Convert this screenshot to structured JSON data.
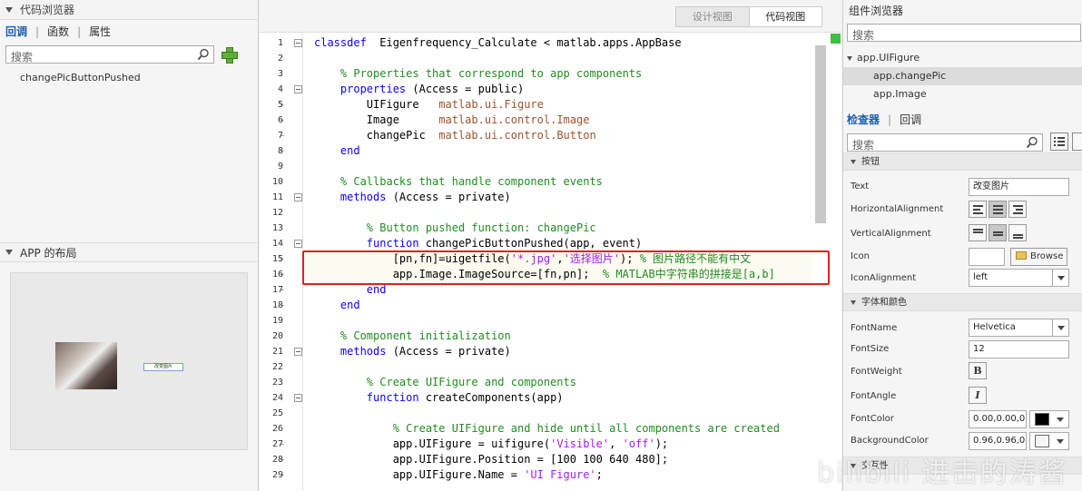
{
  "code_browser": {
    "title": "代码浏览器",
    "tabs": [
      "回调",
      "函数",
      "属性"
    ],
    "search_placeholder": "搜索",
    "callbacks": [
      "changePicButtonPushed"
    ]
  },
  "app_layout": {
    "title": "APP 的布局",
    "button_label": "改变图片"
  },
  "editor": {
    "view_tabs": [
      "设计视图",
      "代码视图"
    ],
    "active_view": "代码视图",
    "lines": [
      {
        "n": 1,
        "segs": [
          [
            "kw",
            "classdef"
          ],
          [
            "",
            "  Eigenfrequency_Calculate < matlab.apps.AppBase"
          ]
        ]
      },
      {
        "n": 2,
        "segs": []
      },
      {
        "n": 3,
        "segs": [
          [
            "",
            "    "
          ],
          [
            "cm",
            "% Properties that correspond to app components"
          ]
        ]
      },
      {
        "n": 4,
        "segs": [
          [
            "",
            "    "
          ],
          [
            "kw",
            "properties"
          ],
          [
            "",
            " (Access = public)"
          ]
        ]
      },
      {
        "n": 5,
        "segs": [
          [
            "",
            "        UIFigure   "
          ],
          [
            "cls",
            "matlab.ui.Figure"
          ]
        ]
      },
      {
        "n": 6,
        "segs": [
          [
            "",
            "        Image      "
          ],
          [
            "cls",
            "matlab.ui.control.Image"
          ]
        ]
      },
      {
        "n": 7,
        "segs": [
          [
            "",
            "        changePic  "
          ],
          [
            "cls",
            "matlab.ui.control.Button"
          ]
        ]
      },
      {
        "n": 8,
        "segs": [
          [
            "",
            "    "
          ],
          [
            "kw",
            "end"
          ]
        ]
      },
      {
        "n": 9,
        "segs": []
      },
      {
        "n": 10,
        "segs": [
          [
            "",
            "    "
          ],
          [
            "cm",
            "% Callbacks that handle component events"
          ]
        ]
      },
      {
        "n": 11,
        "segs": [
          [
            "",
            "    "
          ],
          [
            "kw",
            "methods"
          ],
          [
            "",
            " (Access = private)"
          ]
        ]
      },
      {
        "n": 12,
        "segs": []
      },
      {
        "n": 13,
        "segs": [
          [
            "",
            "        "
          ],
          [
            "cm",
            "% Button pushed function: changePic"
          ]
        ]
      },
      {
        "n": 14,
        "segs": [
          [
            "",
            "        "
          ],
          [
            "kw",
            "function"
          ],
          [
            "",
            " changePicButtonPushed(app, event)"
          ]
        ]
      },
      {
        "n": 15,
        "segs": [
          [
            "",
            "            [pn,fn]=uigetfile("
          ],
          [
            "st",
            "'*.jpg'"
          ],
          [
            "",
            ","
          ],
          [
            "st",
            "'选择图片'"
          ],
          [
            "",
            "); "
          ],
          [
            "cm",
            "% 图片路径不能有中文"
          ]
        ]
      },
      {
        "n": 16,
        "segs": [
          [
            "",
            "            app.Image.ImageSource=[fn,pn];  "
          ],
          [
            "cm",
            "% MATLAB中字符串的拼接是[a,b]"
          ]
        ]
      },
      {
        "n": 17,
        "segs": [
          [
            "",
            "        "
          ],
          [
            "kw",
            "end"
          ]
        ]
      },
      {
        "n": 18,
        "segs": [
          [
            "",
            "    "
          ],
          [
            "kw",
            "end"
          ]
        ]
      },
      {
        "n": 19,
        "segs": []
      },
      {
        "n": 20,
        "segs": [
          [
            "",
            "    "
          ],
          [
            "cm",
            "% Component initialization"
          ]
        ]
      },
      {
        "n": 21,
        "segs": [
          [
            "",
            "    "
          ],
          [
            "kw",
            "methods"
          ],
          [
            "",
            " (Access = private)"
          ]
        ]
      },
      {
        "n": 22,
        "segs": []
      },
      {
        "n": 23,
        "segs": [
          [
            "",
            "        "
          ],
          [
            "cm",
            "% Create UIFigure and components"
          ]
        ]
      },
      {
        "n": 24,
        "segs": [
          [
            "",
            "        "
          ],
          [
            "kw",
            "function"
          ],
          [
            "",
            " createComponents(app)"
          ]
        ]
      },
      {
        "n": 25,
        "segs": []
      },
      {
        "n": 26,
        "segs": [
          [
            "",
            "            "
          ],
          [
            "cm",
            "% Create UIFigure and hide until all components are created"
          ]
        ]
      },
      {
        "n": 27,
        "segs": [
          [
            "",
            "            app.UIFigure = uifigure("
          ],
          [
            "st",
            "'Visible'"
          ],
          [
            "",
            ", "
          ],
          [
            "st",
            "'off'"
          ],
          [
            "",
            ");"
          ]
        ]
      },
      {
        "n": 28,
        "segs": [
          [
            "",
            "            app.UIFigure.Position = [100 100 640 480];"
          ]
        ]
      },
      {
        "n": 29,
        "segs": [
          [
            "",
            "            app.UIFigure.Name = "
          ],
          [
            "st",
            "'UI Figure'"
          ],
          [
            "",
            ";"
          ]
        ]
      }
    ]
  },
  "component_browser": {
    "title": "组件浏览器",
    "search_placeholder": "搜索",
    "tree": [
      "app.UIFigure",
      "app.changePic",
      "app.Image"
    ],
    "selected": "app.changePic"
  },
  "inspector": {
    "tabs": [
      "检查器",
      "回调"
    ],
    "search_placeholder": "搜索",
    "section_button": "按钮",
    "section_font": "字体和颜色",
    "section_interact": "交互性",
    "props": {
      "text_label": "Text",
      "text_value": "改变图片",
      "halign_label": "HorizontalAlignment",
      "valign_label": "VerticalAlignment",
      "icon_label": "Icon",
      "browse_label": "Browse",
      "iconalign_label": "IconAlignment",
      "iconalign_value": "left",
      "fontname_label": "FontName",
      "fontname_value": "Helvetica",
      "fontsize_label": "FontSize",
      "fontsize_value": "12",
      "fontweight_label": "FontWeight",
      "fontweight_glyph": "B",
      "fontangle_label": "FontAngle",
      "fontangle_glyph": "I",
      "fontcolor_label": "FontColor",
      "fontcolor_value": "0.00,0.00,0.0",
      "bgcolor_label": "BackgroundColor",
      "bgcolor_value": "0.96,0.96,0.9"
    },
    "colors": {
      "font": "#000000",
      "background": "#f5f5f5"
    }
  },
  "watermark": "bilibili 进击的涛酱"
}
